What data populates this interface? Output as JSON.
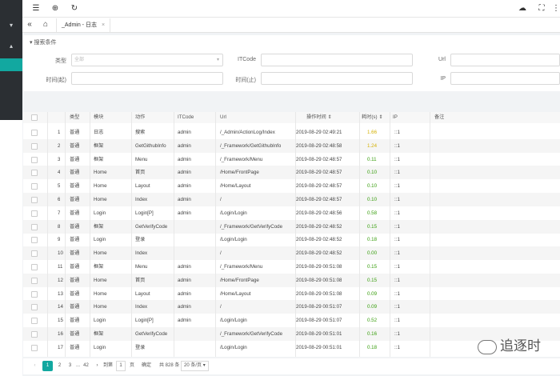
{
  "tab": {
    "label": "_Admin - 日志",
    "close": "×"
  },
  "search": {
    "title": "搜索条件",
    "fields": [
      {
        "label": "类型",
        "placeholder": "全部",
        "type": "select"
      },
      {
        "label": "ITCode",
        "placeholder": ""
      },
      {
        "label": "Url",
        "placeholder": ""
      },
      {
        "label": "时间(起)",
        "placeholder": ""
      },
      {
        "label": "时间(止)",
        "placeholder": ""
      },
      {
        "label": "IP",
        "placeholder": ""
      }
    ]
  },
  "table": {
    "columns": [
      "",
      "类型",
      "模块",
      "动作",
      "ITCode",
      "Url",
      "操作时间",
      "耗时(s)",
      "IP",
      "备注"
    ],
    "sort_marks": {
      "time": "⇕",
      "duration": "⇕"
    },
    "rows": [
      {
        "n": "1",
        "type": "普通",
        "module": "日志",
        "action": "搜索",
        "itcode": "admin",
        "url": "/_Admin/ActionLog/Index",
        "time": "2019-08-29 02:49:21",
        "dur": "1.66",
        "ip": "::1",
        "durColor": "#d4b106"
      },
      {
        "n": "2",
        "type": "普通",
        "module": "框架",
        "action": "GetGithubInfo",
        "itcode": "admin",
        "url": "/_Framework/GetGithubInfo",
        "time": "2019-08-29 02:48:58",
        "dur": "1.24",
        "ip": "::1",
        "durColor": "#d4b106"
      },
      {
        "n": "3",
        "type": "普通",
        "module": "框架",
        "action": "Menu",
        "itcode": "admin",
        "url": "/_Framework/Menu",
        "time": "2019-08-29 02:48:57",
        "dur": "0.11",
        "ip": "::1",
        "durColor": "#389e0d"
      },
      {
        "n": "4",
        "type": "普通",
        "module": "Home",
        "action": "首页",
        "itcode": "admin",
        "url": "/Home/FrontPage",
        "time": "2019-08-29 02:48:57",
        "dur": "0.10",
        "ip": "::1",
        "durColor": "#389e0d"
      },
      {
        "n": "5",
        "type": "普通",
        "module": "Home",
        "action": "Layout",
        "itcode": "admin",
        "url": "/Home/Layout",
        "time": "2019-08-29 02:48:57",
        "dur": "0.10",
        "ip": "::1",
        "durColor": "#389e0d"
      },
      {
        "n": "6",
        "type": "普通",
        "module": "Home",
        "action": "Index",
        "itcode": "admin",
        "url": "/",
        "time": "2019-08-29 02:48:57",
        "dur": "0.10",
        "ip": "::1",
        "durColor": "#389e0d"
      },
      {
        "n": "7",
        "type": "普通",
        "module": "Login",
        "action": "Login[P]",
        "itcode": "admin",
        "url": "/Login/Login",
        "time": "2019-08-29 02:48:56",
        "dur": "0.58",
        "ip": "::1",
        "durColor": "#389e0d"
      },
      {
        "n": "8",
        "type": "普通",
        "module": "框架",
        "action": "GetVerifyCode",
        "itcode": "",
        "url": "/_Framework/GetVerifyCode",
        "time": "2019-08-29 02:48:52",
        "dur": "0.15",
        "ip": "::1",
        "durColor": "#389e0d"
      },
      {
        "n": "9",
        "type": "普通",
        "module": "Login",
        "action": "登录",
        "itcode": "",
        "url": "/Login/Login",
        "time": "2019-08-29 02:48:52",
        "dur": "0.18",
        "ip": "::1",
        "durColor": "#389e0d"
      },
      {
        "n": "10",
        "type": "普通",
        "module": "Home",
        "action": "Index",
        "itcode": "",
        "url": "/",
        "time": "2019-08-29 02:48:52",
        "dur": "0.00",
        "ip": "::1",
        "durColor": "#389e0d"
      },
      {
        "n": "11",
        "type": "普通",
        "module": "框架",
        "action": "Menu",
        "itcode": "admin",
        "url": "/_Framework/Menu",
        "time": "2019-08-29 00:51:08",
        "dur": "0.15",
        "ip": "::1",
        "durColor": "#389e0d"
      },
      {
        "n": "12",
        "type": "普通",
        "module": "Home",
        "action": "首页",
        "itcode": "admin",
        "url": "/Home/FrontPage",
        "time": "2019-08-29 00:51:08",
        "dur": "0.15",
        "ip": "::1",
        "durColor": "#389e0d"
      },
      {
        "n": "13",
        "type": "普通",
        "module": "Home",
        "action": "Layout",
        "itcode": "admin",
        "url": "/Home/Layout",
        "time": "2019-08-29 00:51:08",
        "dur": "0.09",
        "ip": "::1",
        "durColor": "#389e0d"
      },
      {
        "n": "14",
        "type": "普通",
        "module": "Home",
        "action": "Index",
        "itcode": "admin",
        "url": "/",
        "time": "2019-08-29 00:51:07",
        "dur": "0.09",
        "ip": "::1",
        "durColor": "#389e0d"
      },
      {
        "n": "15",
        "type": "普通",
        "module": "Login",
        "action": "Login[P]",
        "itcode": "admin",
        "url": "/Login/Login",
        "time": "2019-08-29 00:51:07",
        "dur": "0.52",
        "ip": "::1",
        "durColor": "#389e0d"
      },
      {
        "n": "16",
        "type": "普通",
        "module": "框架",
        "action": "GetVerifyCode",
        "itcode": "",
        "url": "/_Framework/GetVerifyCode",
        "time": "2019-08-29 00:51:01",
        "dur": "0.16",
        "ip": "::1",
        "durColor": "#389e0d"
      },
      {
        "n": "17",
        "type": "普通",
        "module": "Login",
        "action": "登录",
        "itcode": "",
        "url": "/Login/Login",
        "time": "2019-08-29 00:51:01",
        "dur": "0.18",
        "ip": "::1",
        "durColor": "#389e0d"
      }
    ]
  },
  "pager": {
    "prev": "‹",
    "pages": [
      "1",
      "2",
      "3",
      "...",
      "42"
    ],
    "next": "›",
    "goto_label": "到第",
    "goto_value": "1",
    "page_unit": "页",
    "confirm": "确定",
    "total": "共 828 条",
    "page_size": "20 条/页"
  },
  "watermark": "追逐时",
  "colors": {
    "accent": "#12a8a0",
    "sidebar": "#2b2f33"
  }
}
